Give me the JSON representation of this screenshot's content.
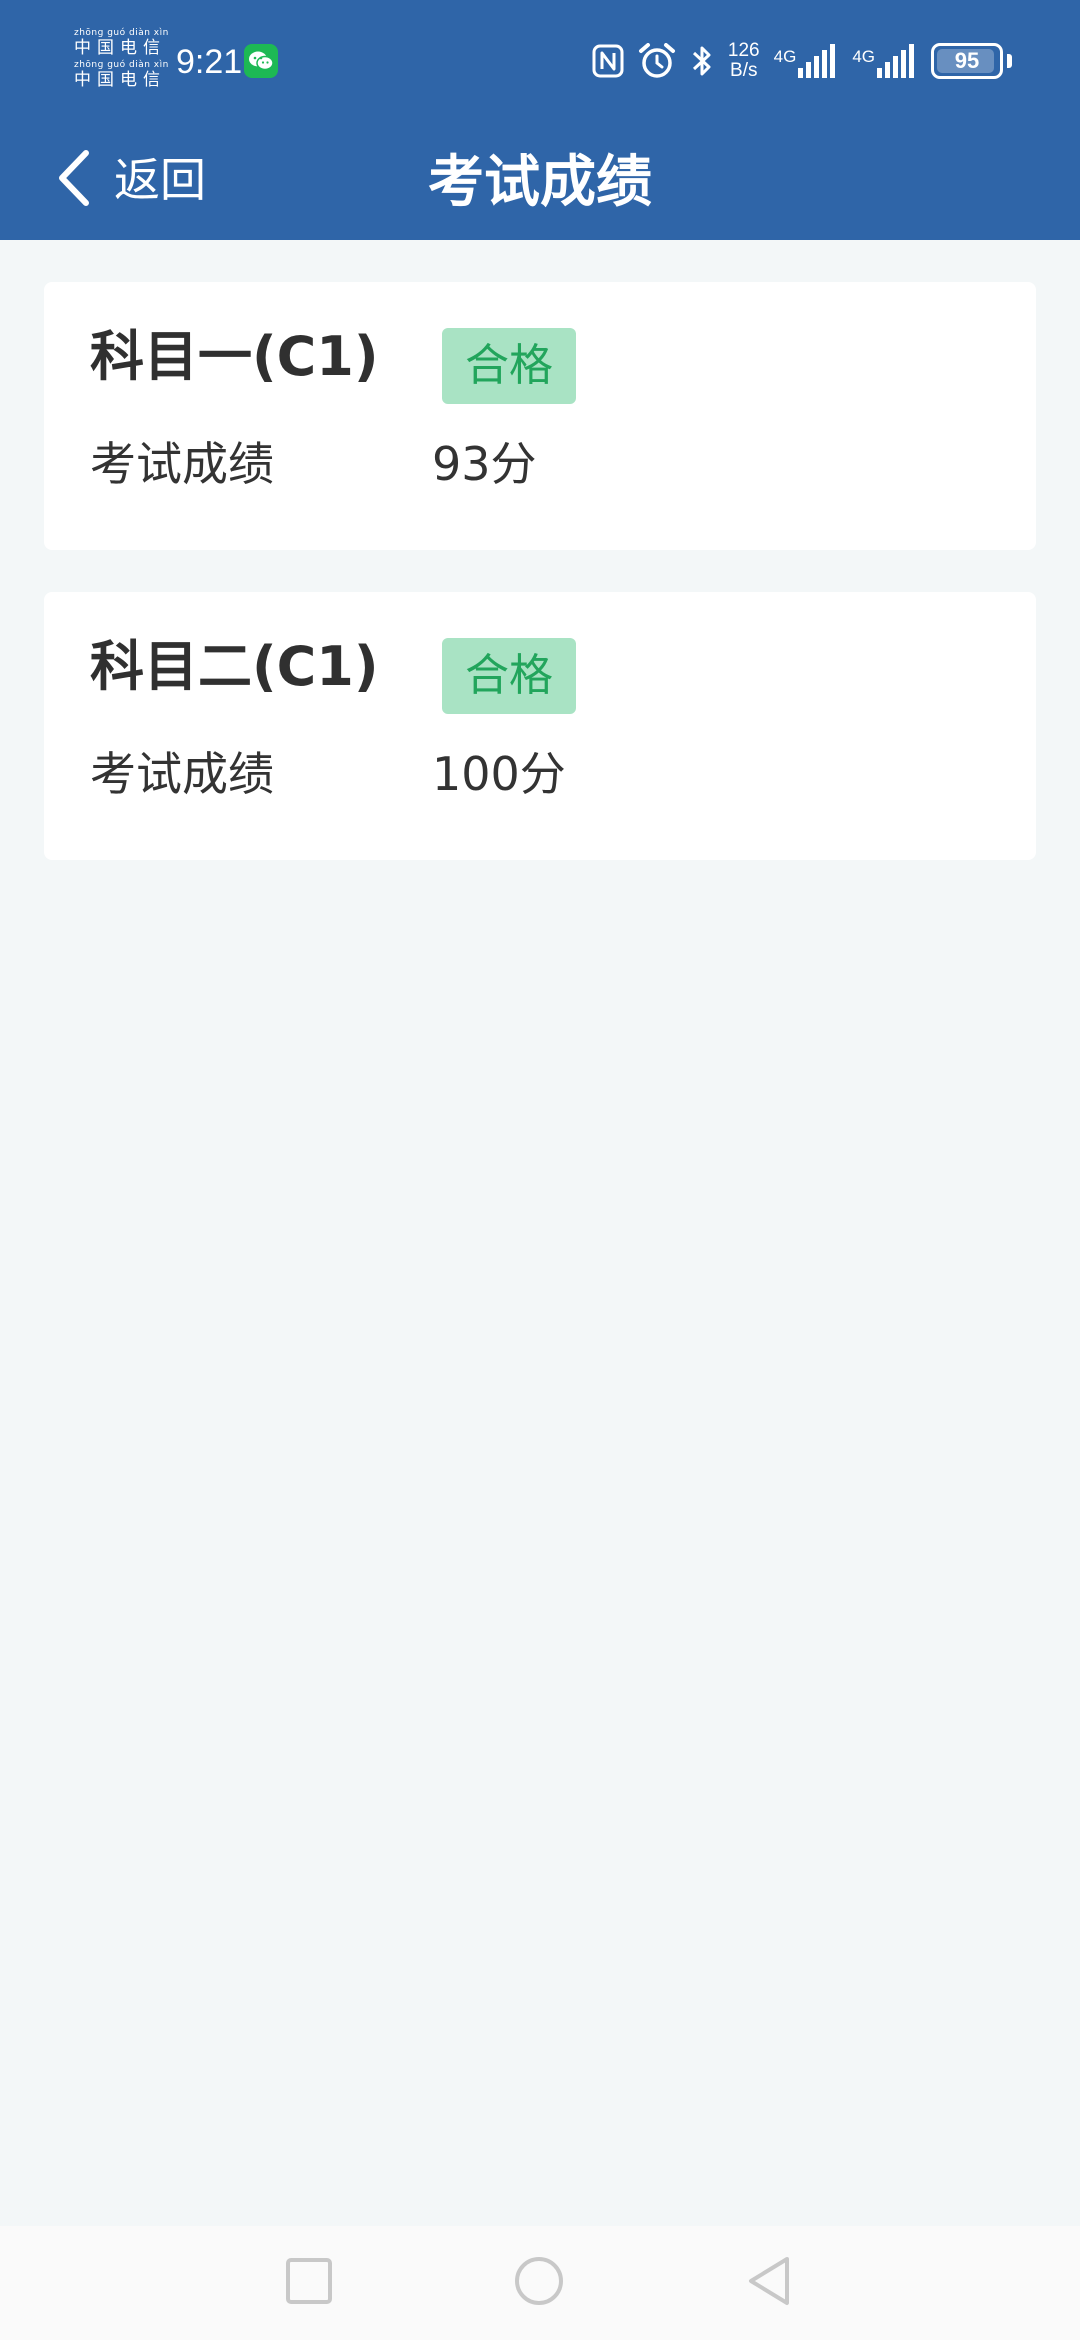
{
  "status_bar": {
    "carrier_lines": [
      {
        "pinyin": "zhōng guó diàn xìn",
        "hanzi": "中国电信"
      },
      {
        "pinyin": "zhōng guó diàn xìn",
        "hanzi": "中国电信"
      }
    ],
    "time": "9:21",
    "net_speed_value": "126",
    "net_speed_unit": "B/s",
    "signal_1_label": "4G",
    "signal_2_label": "4G",
    "battery_level": "95",
    "icons": [
      "wechat-icon",
      "nfc-icon",
      "alarm-icon",
      "bluetooth-icon",
      "signal-icon",
      "battery-icon"
    ]
  },
  "title_bar": {
    "back_label": "返回",
    "title": "考试成绩"
  },
  "exams": [
    {
      "subject": "科目一(C1)",
      "status": "合格",
      "score_label": "考试成绩",
      "score": "93分"
    },
    {
      "subject": "科目二(C1)",
      "status": "合格",
      "score_label": "考试成绩",
      "score": "100分"
    }
  ],
  "colors": {
    "header_bg": "#2f65a8",
    "page_bg": "#f3f7f8",
    "badge_bg": "#a9e3c4",
    "badge_text": "#22a55c"
  },
  "nav_bar": {
    "buttons": [
      "recent-apps",
      "home",
      "back"
    ]
  }
}
